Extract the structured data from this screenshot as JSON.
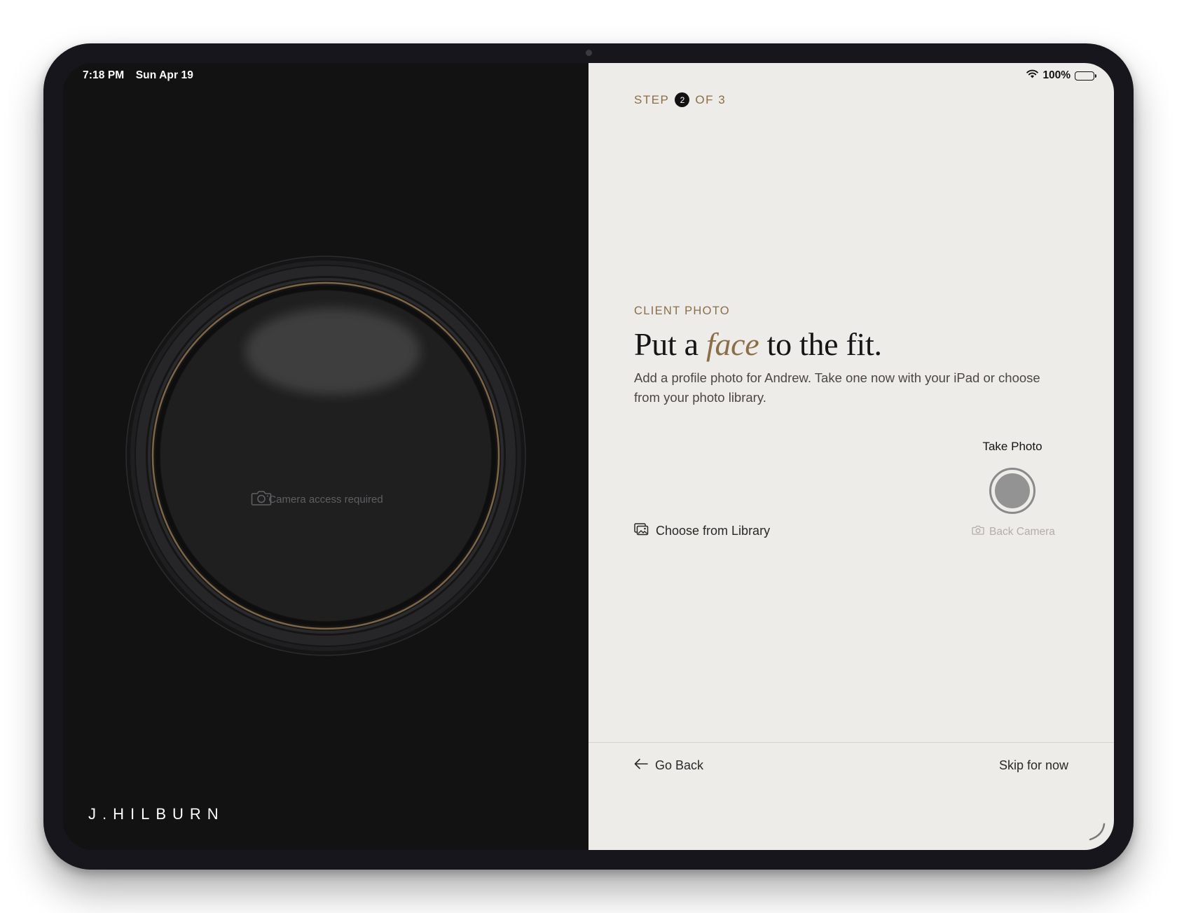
{
  "status_bar": {
    "time": "7:18 PM",
    "date": "Sun Apr 19",
    "battery": "100%",
    "battery_level": 1.0
  },
  "left_panel": {
    "camera_placeholder": "Camera access required",
    "icon": "camera-icon",
    "brand": "J.HILBURN"
  },
  "right_panel": {
    "step": {
      "prefix": "STEP",
      "current": "2",
      "suffix": "OF 3"
    },
    "eyebrow": "CLIENT PHOTO",
    "headline": {
      "before": "Put a",
      "emphasis": "face",
      "after": "to the fit."
    },
    "description": "Add a profile photo for Andrew. Take one now with your iPad or choose from your photo library.",
    "choose_library": "Choose from Library",
    "take_photo": "Take Photo",
    "back_camera": "Back Camera",
    "footer": {
      "go_back": "Go Back",
      "skip": "Skip for now"
    }
  },
  "colors": {
    "accent": "#8a6e48",
    "dark_bg": "#121212",
    "light_bg": "#eeece8",
    "device_frame": "#17161c"
  }
}
